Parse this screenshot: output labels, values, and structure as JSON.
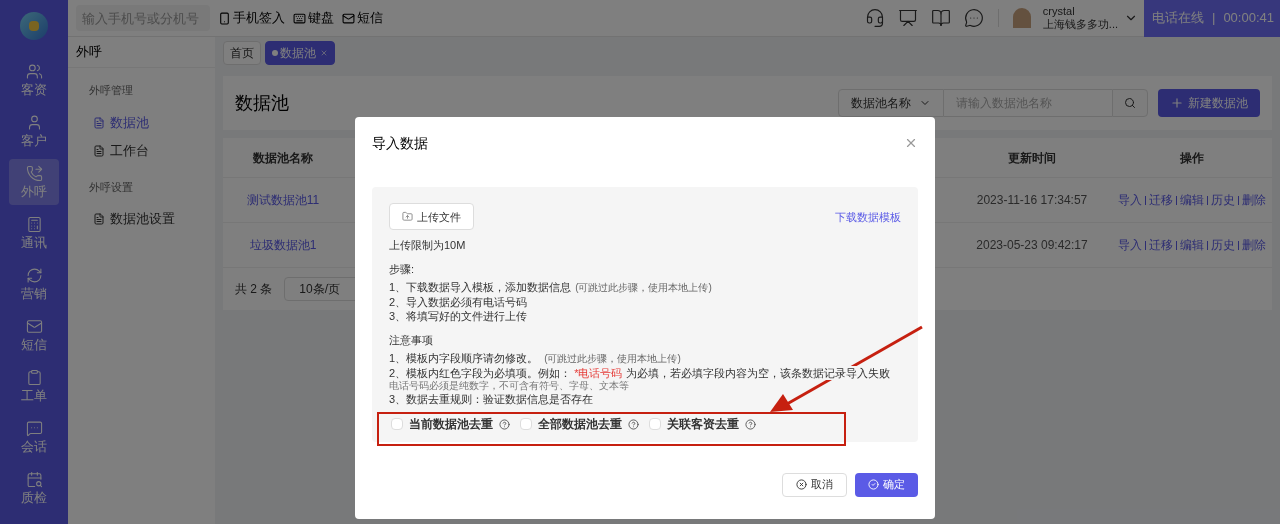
{
  "topbar": {
    "search": {
      "placeholder": "输入手机号或分机号"
    },
    "actions": [
      "手机签入",
      "键盘",
      "短信"
    ],
    "user": {
      "name": "crystal",
      "company": "上海钱多多功..."
    },
    "phone": {
      "status": "电话在线",
      "separator": "|",
      "timer": "00:00:41"
    }
  },
  "rail": [
    {
      "label": "客资",
      "selected": false
    },
    {
      "label": "客户",
      "selected": false
    },
    {
      "label": "外呼",
      "selected": true
    },
    {
      "label": "通讯",
      "selected": false
    },
    {
      "label": "营销",
      "selected": false
    },
    {
      "label": "短信",
      "selected": false
    },
    {
      "label": "工单",
      "selected": false
    },
    {
      "label": "会话",
      "selected": false
    },
    {
      "label": "质检",
      "selected": false
    }
  ],
  "submenu": {
    "title": "外呼",
    "groups": [
      {
        "title": "外呼管理",
        "items": [
          {
            "label": "数据池",
            "selected": true
          },
          {
            "label": "工作台",
            "selected": false
          }
        ]
      },
      {
        "title": "外呼设置",
        "items": [
          {
            "label": "数据池设置",
            "selected": false
          }
        ]
      }
    ]
  },
  "tabs": [
    {
      "label": "首页",
      "selected": false,
      "closable": false
    },
    {
      "label": "数据池",
      "selected": true,
      "closable": true
    }
  ],
  "page": {
    "title": "数据池",
    "filter": {
      "select": "数据池名称",
      "placeholder": "请输入数据池名称"
    },
    "new_button": "新建数据池",
    "table": {
      "columns": [
        "数据池名称",
        "更新时间",
        "操作"
      ],
      "rows": [
        {
          "name": "测试数据池11",
          "updated": "2023-11-16 17:34:57",
          "actions": [
            "导入",
            "迁移",
            "编辑",
            "历史",
            "删除"
          ]
        },
        {
          "name": "垃圾数据池1",
          "updated": "2023-05-23 09:42:17",
          "actions": [
            "导入",
            "迁移",
            "编辑",
            "历史",
            "删除"
          ]
        }
      ]
    },
    "pagination": {
      "total": "共 2 条",
      "page_size": "10条/页"
    }
  },
  "dialog": {
    "title": "导入数据",
    "upload_button": "上传文件",
    "template_link": "下载数据模板",
    "limit": "上传限制为10M",
    "steps_title": "步骤:",
    "steps": [
      {
        "text": "1、下载数据导入模板，添加数据信息",
        "hint": "(可跳过此步骤，使用本地上传)"
      },
      {
        "text": "2、导入数据必须有电话号码"
      },
      {
        "text": "3、将填写好的文件进行上传"
      }
    ],
    "notes_title": "注意事项",
    "note_1": {
      "text": "1、模板内字段顺序请勿修改。",
      "hint": "(可跳过此步骤，使用本地上传)"
    },
    "note_2": {
      "before": "2、模板内红色字段为必填项。例如：",
      "required_field": "*电话号码",
      "after": "为必填，若必填字段内容为空，该条数据记录导入失败"
    },
    "note_2_hint": "电话号码必须是纯数字，不可含有符号、字母、文本等",
    "note_3": "3、数据去重规则：验证数据信息是否存在",
    "dedupe": [
      {
        "label": "当前数据池去重",
        "checked": false
      },
      {
        "label": "全部数据池去重",
        "checked": false
      },
      {
        "label": "关联客资去重",
        "checked": false
      }
    ],
    "buttons": [
      {
        "label": "取消",
        "kind": "cancel"
      },
      {
        "label": "确定",
        "kind": "confirm"
      }
    ]
  }
}
